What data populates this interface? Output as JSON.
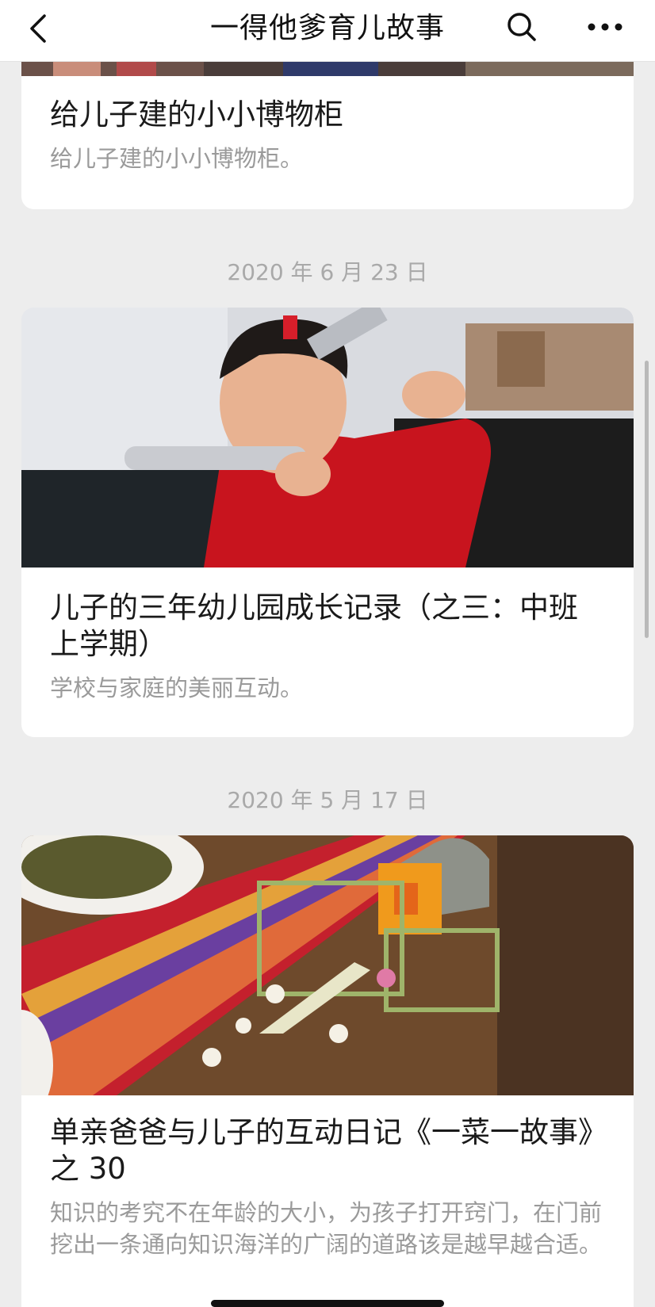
{
  "header": {
    "title": "一得他爹育儿故事"
  },
  "articles": [
    {
      "title": "给儿子建的小小博物柜",
      "desc": "给儿子建的小小博物柜。"
    },
    {
      "date": "2020 年 6 月 23 日",
      "title": "儿子的三年幼儿园成长记录（之三：中班上学期）",
      "desc": "学校与家庭的美丽互动。"
    },
    {
      "date": "2020 年 5 月 17 日",
      "title": "单亲爸爸与儿子的互动日记《一菜一故事》之 30",
      "desc": "知识的考究不在年龄的大小，为孩子打开窍门，在门前挖出一条通向知识海洋的广阔的道路该是越早越合适。"
    }
  ],
  "colors": {
    "background": "#ededed",
    "card": "#ffffff",
    "date_text": "#a9a9a9",
    "desc_text": "#9a9a9a"
  }
}
